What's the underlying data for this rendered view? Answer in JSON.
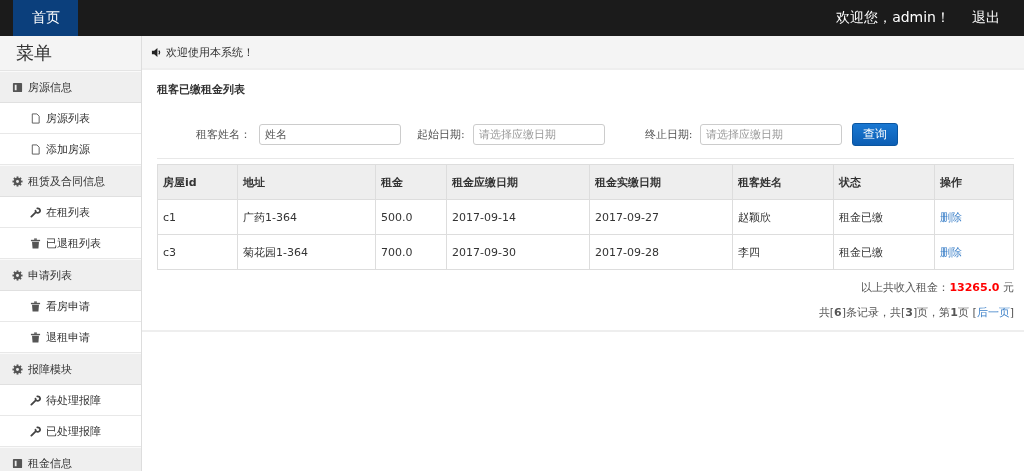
{
  "top_bar": {
    "home_tab": {
      "label": "首页",
      "selected": true
    },
    "greeting": "欢迎您，admin！",
    "logout": "退出"
  },
  "sidebar": {
    "title": "菜单",
    "groups": [
      {
        "label": "房源信息",
        "kind": "book",
        "items": [
          {
            "label": "房源列表",
            "kind": "file"
          },
          {
            "label": "添加房源",
            "kind": "file"
          }
        ]
      },
      {
        "label": "租赁及合同信息",
        "kind": "gear",
        "items": [
          {
            "label": "在租列表",
            "kind": "wrench"
          },
          {
            "label": "已退租列表",
            "kind": "trash"
          }
        ]
      },
      {
        "label": "申请列表",
        "kind": "gear",
        "items": [
          {
            "label": "看房申请",
            "kind": "trash"
          },
          {
            "label": "退租申请",
            "kind": "trash"
          }
        ]
      },
      {
        "label": "报障模块",
        "kind": "gear",
        "items": [
          {
            "label": "待处理报障",
            "kind": "wrench"
          },
          {
            "label": "已处理报障",
            "kind": "wrench"
          }
        ]
      },
      {
        "label": "租金信息",
        "kind": "book"
      }
    ]
  },
  "notice": "欢迎使用本系统！",
  "panel_title": "租客已缴租金列表",
  "filters": [
    {
      "label": "租客姓名：",
      "placeholder": "姓名"
    },
    {
      "label": "起始日期:",
      "placeholder": "请选择应缴日期"
    },
    {
      "label": "终止日期:",
      "placeholder": "请选择应缴日期"
    }
  ],
  "search_button": "查询",
  "table": {
    "columns": [
      "房屋id",
      "地址",
      "租金",
      "租金应缴日期",
      "租金实缴日期",
      "租客姓名",
      "状态",
      "操作"
    ],
    "rows": [
      {
        "cells": [
          "c1",
          "广药1-364",
          "500.0",
          "2017-09-14",
          "2017-09-27",
          "赵颖欣",
          "租金已缴"
        ],
        "action": "删除"
      },
      {
        "cells": [
          "c3",
          "菊花园1-364",
          "700.0",
          "2017-09-30",
          "2017-09-28",
          "李四",
          "租金已缴"
        ],
        "action": "删除"
      }
    ]
  },
  "total": {
    "label": "以上共收入租金：",
    "amount": "13265.0",
    "unit": " 元"
  },
  "pagination": {
    "text": "共[**6**]条记录，共[**3**]页，第**1**页 [",
    "link": "后一页",
    "text_after": "]"
  }
}
